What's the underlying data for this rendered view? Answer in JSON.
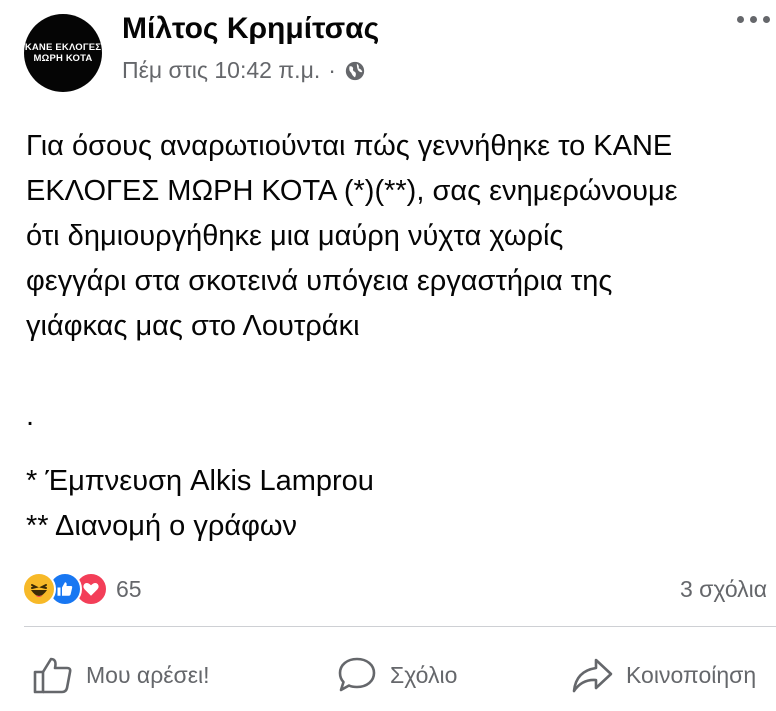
{
  "post": {
    "avatar_text_line1": "ΚΑΝΕ ΕΚΛΟΓΕΣ",
    "avatar_text_line2": "ΜΩΡΗ ΚΟΤΑ",
    "author": "Μίλτος Κρημίτσας",
    "timestamp": "Πέμ στις 10:42 π.μ.",
    "separator": "·",
    "privacy_icon": "globe-icon",
    "body_lines": [
      "Για όσους αναρωτιούνται πώς γεννήθηκε το ΚΑΝΕ",
      "ΕΚΛΟΓΕΣ ΜΩΡΗ ΚΟΤΑ (*)(**), σας ενημερώνουμε",
      "ότι δημιουργήθηκε μια μαύρη νύχτα χωρίς",
      "φεγγάρι στα σκοτεινά υπόγεια εργαστήρια της",
      "γιάφκας μας στο Λουτράκι"
    ],
    "dot_line": ".",
    "footnote1": "* Έμπνευση Alkis Lamprou",
    "footnote2": "** Διανομή ο γράφων"
  },
  "reactions": {
    "icons": [
      "haha-icon",
      "like-icon",
      "love-icon"
    ],
    "count": "65",
    "comments": "3 σχόλια"
  },
  "actions": {
    "like": "Μου αρέσει!",
    "comment": "Σχόλιο",
    "share": "Κοινοποίηση"
  },
  "colors": {
    "like_blue": "#1877f2",
    "love_red": "#f33e58",
    "haha_yellow": "#f7b928",
    "secondary_text": "#65676b"
  }
}
